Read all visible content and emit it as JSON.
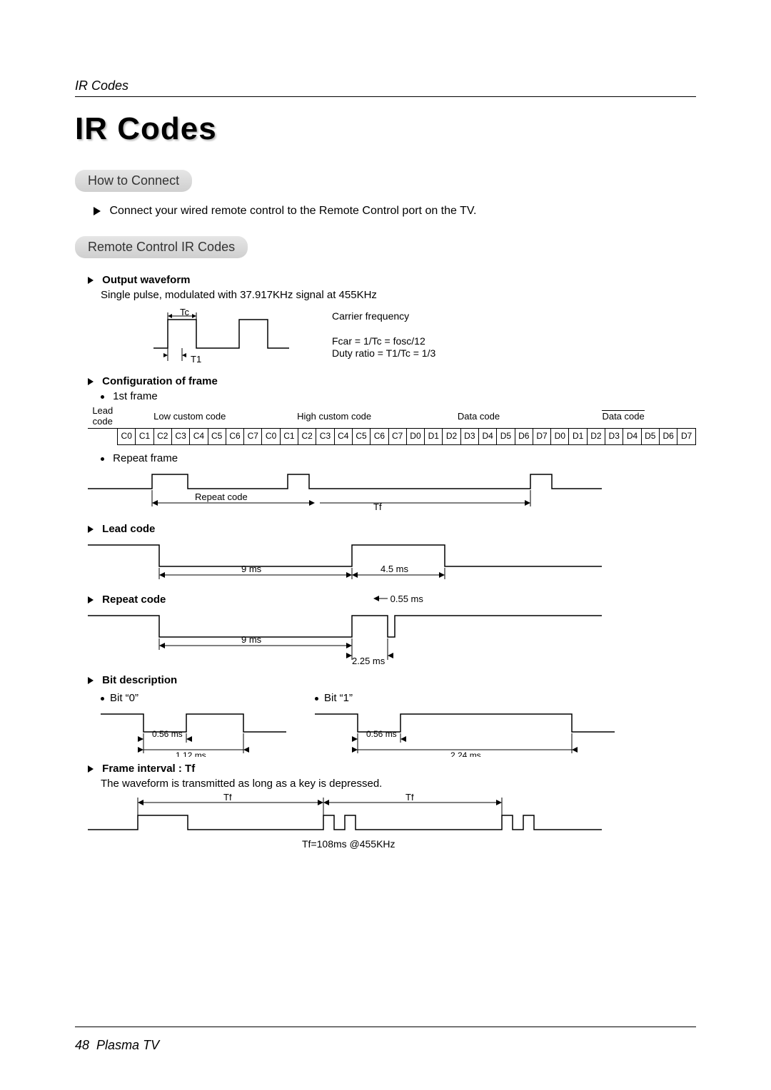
{
  "header": {
    "running": "IR Codes"
  },
  "title": "IR Codes",
  "sections": {
    "connect": {
      "heading": "How to Connect",
      "line": "Connect your wired remote control to the Remote Control port on the TV."
    },
    "ir": {
      "heading": "Remote Control IR Codes",
      "output_waveform": {
        "label": "Output waveform",
        "desc": "Single pulse, modulated with 37.917KHz signal at 455KHz",
        "tc": "Tc",
        "t1": "T1",
        "carrier_label": "Carrier frequency",
        "fcar": "Fcar = 1/Tc = fosc/12",
        "duty": "Duty ratio = T1/Tc = 1/3"
      },
      "config_frame": {
        "label": "Configuration of frame",
        "first_frame": "1st frame",
        "lead_code": "Lead code",
        "low_custom": "Low custom code",
        "high_custom": "High custom code",
        "data_code": "Data code",
        "data_code_inv": "Data code",
        "bits_c": [
          "C0",
          "C1",
          "C2",
          "C3",
          "C4",
          "C5",
          "C6",
          "C7"
        ],
        "bits_d": [
          "D0",
          "D1",
          "D2",
          "D3",
          "D4",
          "D5",
          "D6",
          "D7"
        ],
        "repeat_frame": "Repeat frame",
        "repeat_code": "Repeat code",
        "tf": "Tf"
      },
      "lead_code": {
        "label": "Lead code",
        "t9": "9 ms",
        "t45": "4.5 ms"
      },
      "repeat_code": {
        "label": "Repeat code",
        "t055": "0.55 ms",
        "t9": "9 ms",
        "t225": "2.25 ms"
      },
      "bit_desc": {
        "label": "Bit description",
        "bit0": "Bit “0”",
        "bit1": "Bit “1”",
        "t056": "0.56 ms",
        "t112": "1.12 ms",
        "t224": "2.24 ms"
      },
      "frame_interval": {
        "label": "Frame interval : Tf",
        "desc": "The waveform is transmitted as long as a key is depressed.",
        "tf": "Tf",
        "tf_val": "Tf=108ms @455KHz"
      }
    }
  },
  "footer": {
    "page": "48",
    "book": "Plasma TV"
  },
  "chart_data": [
    {
      "type": "line",
      "title": "Output waveform (carrier pulse)",
      "annotations": [
        "Tc",
        "T1",
        "Carrier frequency",
        "Fcar = 1/Tc = fosc/12",
        "Duty ratio = T1/Tc = 1/3"
      ],
      "frequency_khz": 37.917,
      "oscillator_khz": 455,
      "duty_ratio_fraction": 0.3333
    },
    {
      "type": "table",
      "title": "Configuration of frame — 1st frame",
      "columns": [
        "Lead code",
        "Low custom code",
        "High custom code",
        "Data code",
        "Data code (inverted)"
      ],
      "bit_labels": {
        "Low custom code": [
          "C0",
          "C1",
          "C2",
          "C3",
          "C4",
          "C5",
          "C6",
          "C7"
        ],
        "High custom code": [
          "C0",
          "C1",
          "C2",
          "C3",
          "C4",
          "C5",
          "C6",
          "C7"
        ],
        "Data code": [
          "D0",
          "D1",
          "D2",
          "D3",
          "D4",
          "D5",
          "D6",
          "D7"
        ],
        "Data code (inverted)": [
          "D0",
          "D1",
          "D2",
          "D3",
          "D4",
          "D5",
          "D6",
          "D7"
        ]
      }
    },
    {
      "type": "line",
      "title": "Repeat frame",
      "annotations": [
        "Repeat code",
        "Tf"
      ]
    },
    {
      "type": "line",
      "title": "Lead code timing",
      "x_unit": "ms",
      "segments": [
        {
          "level": "low",
          "duration_ms": 9.0
        },
        {
          "level": "high",
          "duration_ms": 4.5
        }
      ]
    },
    {
      "type": "line",
      "title": "Repeat code timing",
      "x_unit": "ms",
      "segments": [
        {
          "level": "low",
          "duration_ms": 9.0
        },
        {
          "level": "high",
          "duration_ms": 2.25
        },
        {
          "level": "low",
          "duration_ms": 0.55
        }
      ]
    },
    {
      "type": "line",
      "title": "Bit description",
      "x_unit": "ms",
      "series": [
        {
          "name": "Bit \"0\"",
          "low_ms": 0.56,
          "total_ms": 1.12
        },
        {
          "name": "Bit \"1\"",
          "low_ms": 0.56,
          "total_ms": 2.24
        }
      ]
    },
    {
      "type": "line",
      "title": "Frame interval Tf",
      "x_unit": "ms",
      "tf_ms": 108,
      "oscillator_khz": 455,
      "annotations": [
        "Tf",
        "Tf",
        "Tf=108ms @455KHz"
      ]
    }
  ]
}
